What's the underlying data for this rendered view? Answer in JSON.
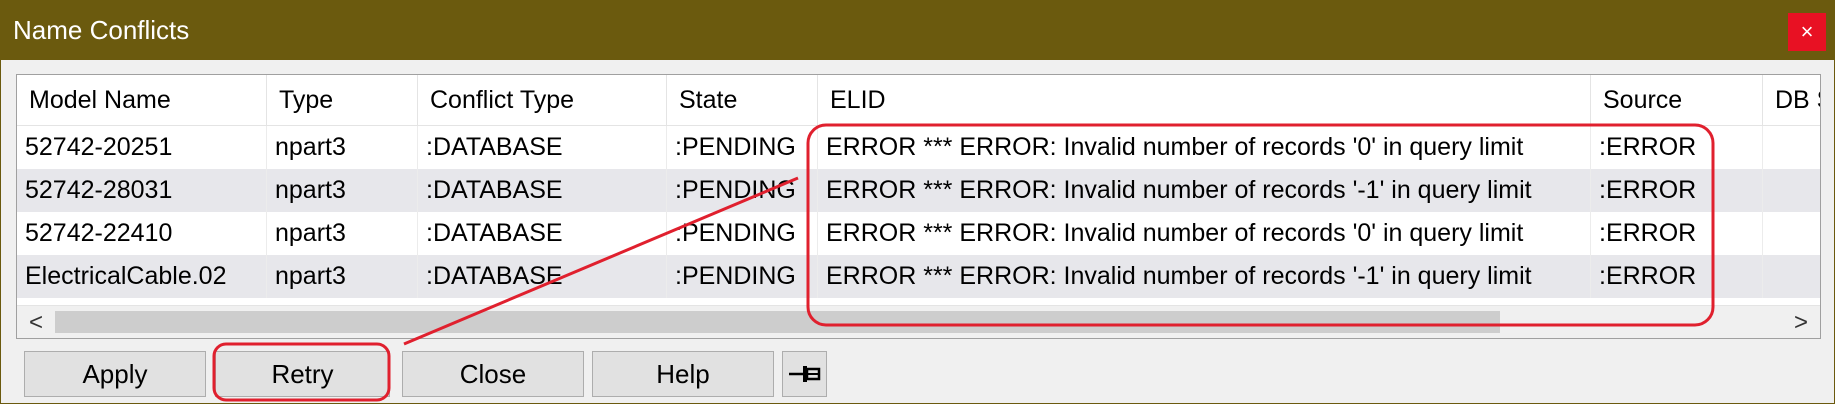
{
  "window": {
    "title": "Name Conflicts",
    "close_glyph": "×"
  },
  "table": {
    "columns": [
      "Model Name",
      "Type",
      "Conflict Type",
      "State",
      "ELID",
      "Source",
      "DB S"
    ],
    "rows": [
      [
        "52742-20251",
        "npart3",
        ":DATABASE",
        ":PENDING",
        "ERROR *** ERROR: Invalid number of records '0' in query limit",
        ":ERROR",
        ""
      ],
      [
        "52742-28031",
        "npart3",
        ":DATABASE",
        ":PENDING",
        "ERROR *** ERROR: Invalid number of records '-1' in query limit",
        ":ERROR",
        ""
      ],
      [
        "52742-22410",
        "npart3",
        ":DATABASE",
        ":PENDING",
        "ERROR *** ERROR: Invalid number of records '0' in query limit",
        ":ERROR",
        ""
      ],
      [
        "ElectricalCable.02",
        "npart3",
        ":DATABASE",
        ":PENDING",
        "ERROR *** ERROR: Invalid number of records '-1' in query limit",
        ":ERROR",
        ""
      ]
    ]
  },
  "scrollbar": {
    "left_arrow": "<",
    "right_arrow": ">"
  },
  "buttons": {
    "apply": "Apply",
    "retry": "Retry",
    "close": "Close",
    "help": "Help"
  },
  "icons": {
    "pin": "pin-icon"
  },
  "colors": {
    "titlebar": "#6b5a0e",
    "close": "#e81123",
    "annotation": "#e0202e",
    "row_alt": "#e7e7eb"
  }
}
